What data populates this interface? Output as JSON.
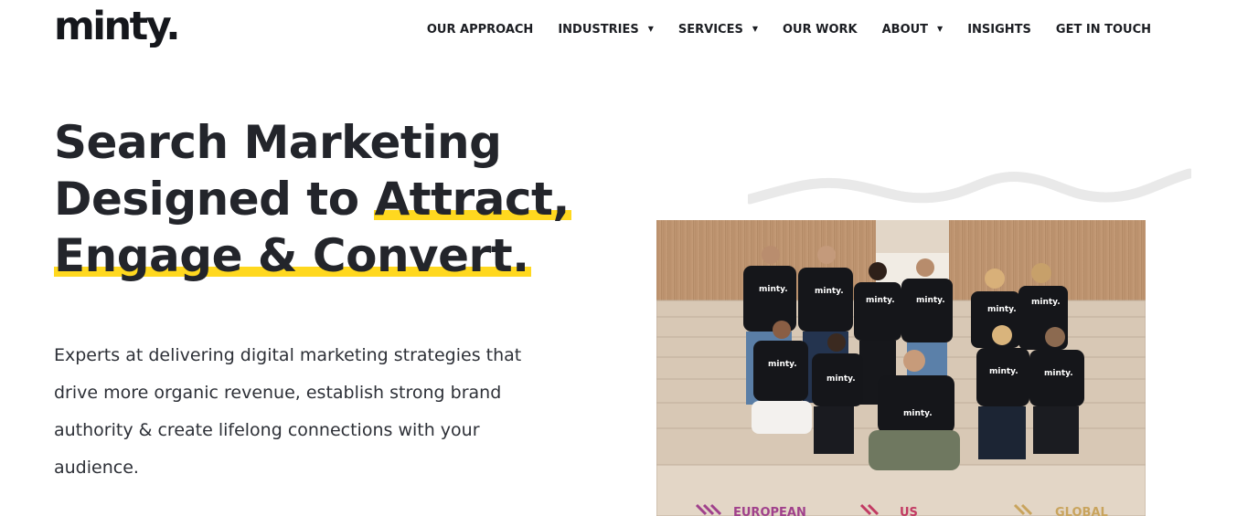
{
  "brand": {
    "logo_text": "minty."
  },
  "nav": {
    "items": [
      {
        "label": "OUR APPROACH",
        "dropdown": false
      },
      {
        "label": "INDUSTRIES",
        "dropdown": true
      },
      {
        "label": "SERVICES",
        "dropdown": true
      },
      {
        "label": "OUR WORK",
        "dropdown": false
      },
      {
        "label": "ABOUT",
        "dropdown": true
      },
      {
        "label": "INSIGHTS",
        "dropdown": false
      },
      {
        "label": "GET IN TOUCH",
        "dropdown": false
      }
    ],
    "caret_glyph": "▼"
  },
  "hero": {
    "headline": {
      "line1": "Search Marketing",
      "line2_plain": "Designed to ",
      "line2_highlight": "Attract,",
      "line3_highlight": "Engage & Convert."
    },
    "subtext_lines": [
      "Experts at delivering digital marketing strategies that",
      "drive more organic revenue, establish strong brand",
      "authority & create lifelong connections with your",
      "audience."
    ],
    "highlight_color": "#ffd81f"
  },
  "team_photo": {
    "shirt_text": "minty.",
    "awards": [
      "EUROPEAN",
      "US",
      "GLOBAL"
    ]
  }
}
